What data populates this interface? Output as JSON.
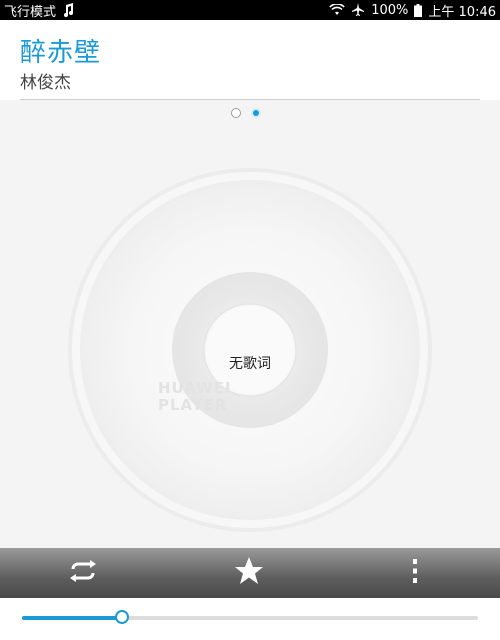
{
  "status_bar": {
    "mode_text": "飞行模式",
    "battery_text": "100%",
    "time_text": "上午 10:46"
  },
  "song": {
    "title": "醉赤壁",
    "artist": "林俊杰"
  },
  "pager": {
    "pages": 2,
    "active_index": 1
  },
  "disc": {
    "brand_line1": "HUAWEI",
    "brand_line2": "PLAYER",
    "lyrics_text": "无歌词"
  },
  "toolbar": {
    "buttons": [
      "repeat-icon",
      "star-icon",
      "more-vert-icon"
    ]
  },
  "playback": {
    "progress_fraction": 0.22
  },
  "colors": {
    "accent": "#1a9bd7"
  }
}
